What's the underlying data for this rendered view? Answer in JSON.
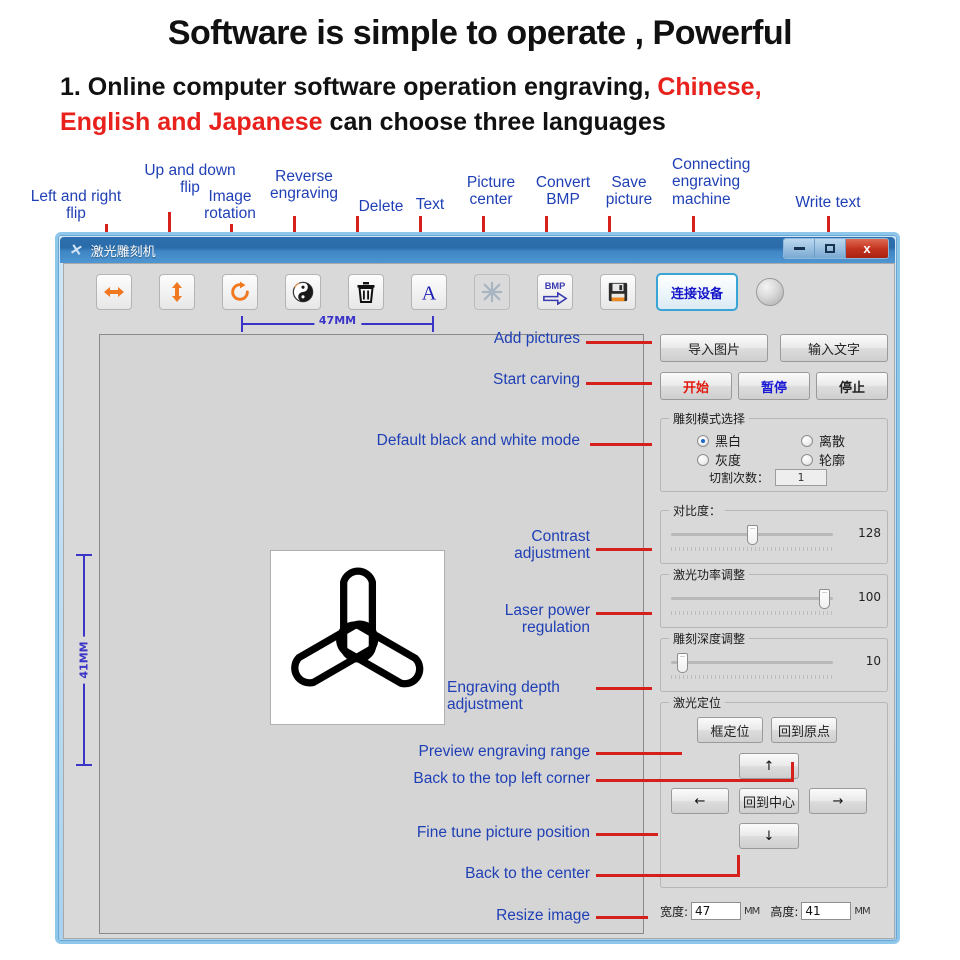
{
  "promo": {
    "title": "Software is simple to operate , Powerful",
    "line1_a": "1. Online computer software operation engraving, ",
    "line1_b": "Chinese,",
    "line2_a": "English and Japanese",
    "line2_b": " can choose three languages"
  },
  "callouts": {
    "left_right_flip": "Left and right\nflip",
    "up_down_flip": "Up and down\nflip",
    "image_rotation": "Image\nrotation",
    "reverse_engraving": "Reverse\nengraving",
    "delete": "Delete",
    "text": "Text",
    "picture_center": "Picture\ncenter",
    "convert_bmp": "Convert\nBMP",
    "save_picture": "Save\npicture",
    "connecting_machine": "Connecting\nengraving\nmachine",
    "write_text": "Write text",
    "add_pictures": "Add pictures",
    "start_carving": "Start carving",
    "default_bw_mode": "Default black and white mode",
    "contrast_adjustment": "Contrast\nadjustment",
    "laser_power_regulation": "Laser power\nregulation",
    "engraving_depth_adjustment": "Engraving depth\nadjustment",
    "preview_engraving_range": "Preview engraving range",
    "back_top_left": "Back to the top left corner",
    "fine_tune_position": "Fine tune picture position",
    "back_to_center": "Back to the center",
    "resize_image": "Resize image"
  },
  "window": {
    "title": "激光雕刻机",
    "minimize_label": "minimize",
    "maximize_label": "maximize",
    "close_label": "x"
  },
  "toolbar": {
    "buttons": [
      {
        "name": "flip-horizontal",
        "icon": "arrows-left-right-icon"
      },
      {
        "name": "flip-vertical",
        "icon": "arrows-up-down-icon"
      },
      {
        "name": "rotate",
        "icon": "rotate-cw-icon"
      },
      {
        "name": "invert",
        "icon": "yin-yang-icon"
      },
      {
        "name": "delete",
        "icon": "trash-icon"
      },
      {
        "name": "text",
        "icon": "letter-a-icon"
      },
      {
        "name": "center",
        "icon": "asterisk-center-icon"
      },
      {
        "name": "convert-bmp",
        "icon": "bmp-arrow-icon"
      },
      {
        "name": "save",
        "icon": "floppy-disk-icon"
      }
    ],
    "connect_label": "连接设备",
    "bmp_label": "BMP"
  },
  "rulers": {
    "horizontal": "47MM",
    "vertical": "41MM"
  },
  "panel": {
    "import_picture": "导入图片",
    "input_text": "输入文字",
    "start": "开始",
    "pause": "暂停",
    "stop": "停止",
    "mode_group_label": "雕刻模式选择",
    "modes": [
      {
        "label": "黑白",
        "selected": true
      },
      {
        "label": "离散",
        "selected": false
      },
      {
        "label": "灰度",
        "selected": false
      },
      {
        "label": "轮廓",
        "selected": false
      }
    ],
    "cuts_label": "切割次数：",
    "cuts_value": "1",
    "sliders": [
      {
        "label": "对比度：",
        "value": "128",
        "percent": 52
      },
      {
        "label": "激光功率调整",
        "value": "100",
        "percent": 92
      },
      {
        "label": "雕刻深度调整",
        "value": "10",
        "percent": 8
      }
    ],
    "position_group_label": "激光定位",
    "frame_position": "框定位",
    "back_to_origin": "回到原点",
    "back_to_center": "回到中心",
    "arrow_up": "↑",
    "arrow_down": "↓",
    "arrow_left": "←",
    "arrow_right": "→",
    "width_label": "宽度:",
    "width_value": "47",
    "height_label": "高度:",
    "height_value": "41",
    "unit": "MM"
  },
  "colors": {
    "callout_blue": "#1f3fb5",
    "leader_red": "#d6201c",
    "promo_red": "#e8211c",
    "ruler_blue": "#3a34c8",
    "accent_cyan": "#39a4d6"
  }
}
